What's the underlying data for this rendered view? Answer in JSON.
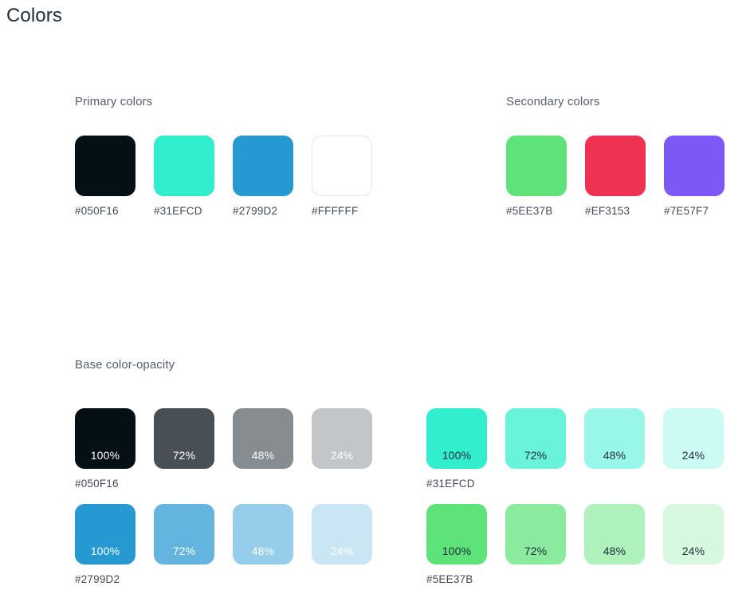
{
  "page": {
    "title": "Colors",
    "title_color": "#1C2B3A",
    "background": "#FFFFFF",
    "heading_color": "#55606B",
    "label_color": "#414B54"
  },
  "sections": {
    "primary": {
      "heading": "Primary colors",
      "swatches": [
        {
          "hex": "#050F16",
          "label": "#050F16",
          "bordered": false
        },
        {
          "hex": "#31EFCD",
          "label": "#31EFCD",
          "bordered": false
        },
        {
          "hex": "#2799D2",
          "label": "#2799D2",
          "bordered": false
        },
        {
          "hex": "#FFFFFF",
          "label": "#FFFFFF",
          "bordered": true
        }
      ]
    },
    "secondary": {
      "heading": "Secondary colors",
      "swatches": [
        {
          "hex": "#5EE37B",
          "label": "#5EE37B",
          "bordered": false
        },
        {
          "hex": "#EF3153",
          "label": "#EF3153",
          "bordered": false
        },
        {
          "hex": "#7E57F7",
          "label": "#7E57F7",
          "bordered": false
        }
      ]
    },
    "base_opacity": {
      "heading": "Base color-opacity",
      "steps": [
        "100%",
        "72%",
        "48%",
        "24%"
      ],
      "groups": [
        {
          "base_hex": "#050F16",
          "label": "#050F16",
          "text_tone": "light",
          "swatches": [
            {
              "pct": "100%",
              "fill": "#050F16"
            },
            {
              "pct": "72%",
              "fill": "#484F55"
            },
            {
              "pct": "48%",
              "fill": "#878C90"
            },
            {
              "pct": "24%",
              "fill": "#C3C6C8"
            }
          ]
        },
        {
          "base_hex": "#31EFCD",
          "label": "#31EFCD",
          "text_tone": "dark",
          "swatches": [
            {
              "pct": "100%",
              "fill": "#31EFCD"
            },
            {
              "pct": "72%",
              "fill": "#69F3DB"
            },
            {
              "pct": "48%",
              "fill": "#98F7E8"
            },
            {
              "pct": "24%",
              "fill": "#CBFBF4"
            }
          ]
        },
        {
          "base_hex": "#2799D2",
          "label": "#2799D2",
          "text_tone": "light",
          "swatches": [
            {
              "pct": "100%",
              "fill": "#2799D2"
            },
            {
              "pct": "72%",
              "fill": "#63B4DF"
            },
            {
              "pct": "48%",
              "fill": "#95CDEA"
            },
            {
              "pct": "24%",
              "fill": "#CAE6F4"
            }
          ]
        },
        {
          "base_hex": "#5EE37B",
          "label": "#5EE37B",
          "text_tone": "dark",
          "swatches": [
            {
              "pct": "100%",
              "fill": "#5EE37B"
            },
            {
              "pct": "72%",
              "fill": "#8AEB9F"
            },
            {
              "pct": "48%",
              "fill": "#AFF1BD"
            },
            {
              "pct": "24%",
              "fill": "#D7F8DE"
            }
          ]
        }
      ]
    }
  }
}
